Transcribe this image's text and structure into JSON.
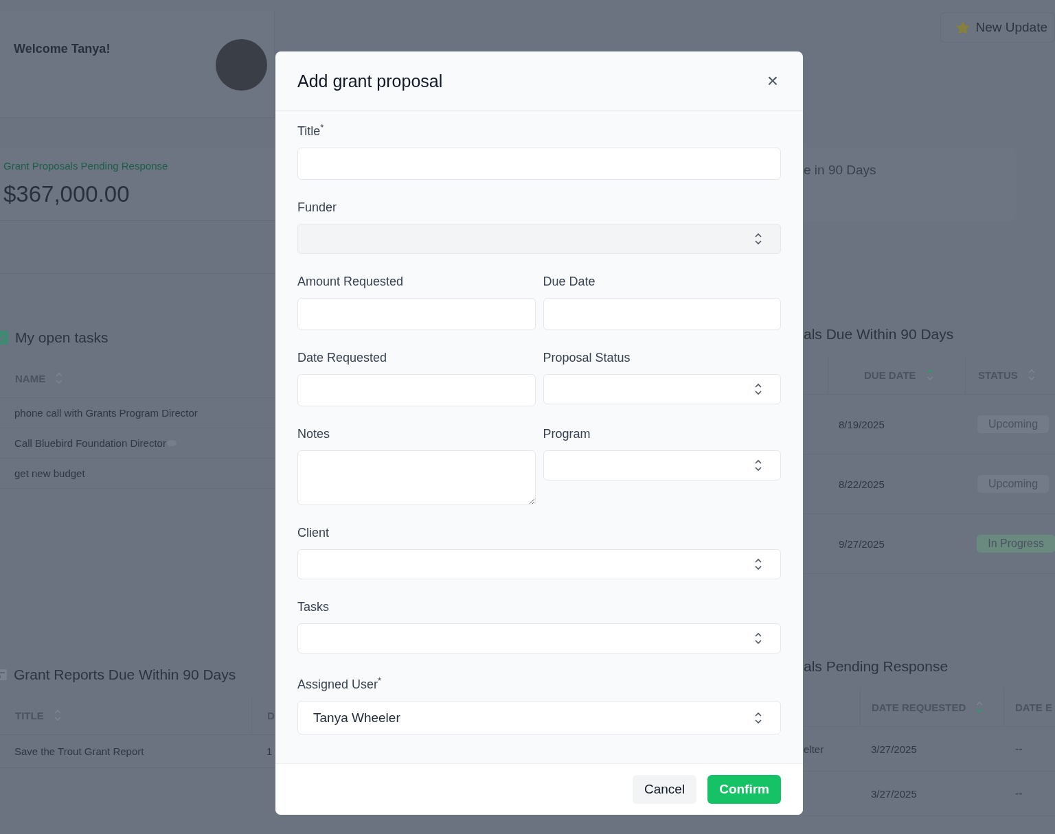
{
  "header": {
    "welcome": "Welcome Tanya!",
    "updates_button": "New Update"
  },
  "stats": [
    {
      "label": "Grant Proposals Pending Response",
      "value": "$367,000.00"
    },
    {
      "label": "e in 90 Days"
    }
  ],
  "open_tasks": {
    "title": "My open tasks",
    "columns": [
      {
        "label": "NAME",
        "sorted_ascending": false,
        "sorted_descending": false
      }
    ],
    "rows": [
      {
        "name": "phone call with Grants Program Director",
        "comment": false
      },
      {
        "name": "Call Bluebird Foundation Director",
        "comment": true
      },
      {
        "name": "get new budget",
        "comment": false
      }
    ]
  },
  "proposals_due": {
    "title": "als Due Within 90 Days",
    "columns": [
      {
        "label": "DUE DATE",
        "sorted_ascending": true,
        "sorted_descending": false
      },
      {
        "label": "STATUS",
        "sorted_ascending": false,
        "sorted_descending": false
      }
    ],
    "rows": [
      {
        "due_date": "8/19/2025",
        "status": "Upcoming",
        "color": "#737b88"
      },
      {
        "due_date": "8/22/2025",
        "status": "Upcoming",
        "color": "#737b88"
      },
      {
        "due_date": "9/27/2025",
        "status": "In Progress",
        "color": "#6a8a80"
      }
    ]
  },
  "reports_due": {
    "title": "Grant Reports Due Within 90 Days",
    "columns": [
      {
        "label": "TITLE",
        "sorted_ascending": false,
        "sorted_descending": false
      },
      {
        "label": "D"
      }
    ],
    "rows": [
      {
        "title": "Save the Trout Grant Report",
        "column_2": "1"
      }
    ]
  },
  "pending": {
    "title": "als Pending Response",
    "columns": [
      {
        "label": "DATE REQUESTED",
        "sorted_ascending": false,
        "sorted_descending": true
      },
      {
        "label": "DATE E"
      }
    ],
    "rows": [
      {
        "column_1": "elter",
        "date_requested": "3/27/2025",
        "date_e": "--"
      },
      {
        "date_requested": "3/27/2025",
        "date_e": "--"
      }
    ]
  },
  "modal": {
    "title": "Add grant proposal",
    "close": "×",
    "rows": [
      [
        {
          "label": "Title$^{*}$",
          "kind": "input",
          "disabled": false
        }
      ],
      [
        {
          "label": "Funder",
          "kind": "select",
          "disabled": true
        }
      ],
      [
        {
          "label": "Amount Requested",
          "kind": "input",
          "disabled": false
        },
        {
          "label": "Due Date",
          "kind": "input",
          "disabled": false
        }
      ],
      [
        {
          "label": "Date Requested",
          "kind": "input",
          "disabled": false
        },
        {
          "label": "Proposal Status",
          "kind": "select",
          "disabled": false
        }
      ],
      [
        {
          "label": "Notes",
          "kind": "textarea",
          "disabled": false
        },
        {
          "label": "Program",
          "kind": "select",
          "disabled": false
        }
      ],
      [
        {
          "label": "Client",
          "kind": "select",
          "disabled": false
        }
      ],
      [
        {
          "label": "Tasks",
          "kind": "select",
          "disabled": false
        }
      ],
      [
        {
          "label": "Assigned User$^{*}$",
          "kind": "select",
          "disabled": false,
          "value": "Tanya Wheeler"
        }
      ]
    ],
    "buttons": [
      {
        "label": "Cancel",
        "kind": "secondary"
      },
      {
        "label": "Confirm",
        "kind": "primary"
      }
    ]
  }
}
